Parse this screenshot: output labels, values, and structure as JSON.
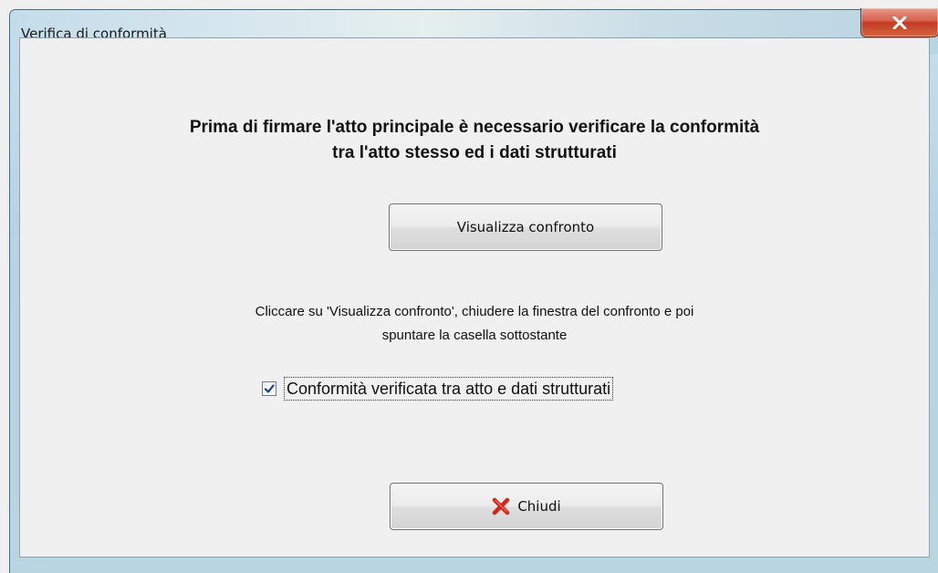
{
  "window": {
    "title": "Verifica di conformità"
  },
  "dialog": {
    "heading_line1": "Prima di firmare l'atto principale è necessario verificare la conformità",
    "heading_line2": "tra l'atto stesso ed i dati strutturati",
    "compare_button_label": "Visualizza confronto",
    "instructions_line1": "Cliccare su 'Visualizza confronto', chiudere la finestra del confronto e poi",
    "instructions_line2": "spuntare la casella sottostante",
    "checkbox_label": "Conformità verificata tra atto e dati strutturati",
    "checkbox_checked": true,
    "close_button_label": "Chiudi",
    "close_button_icon": "red-x-icon"
  }
}
